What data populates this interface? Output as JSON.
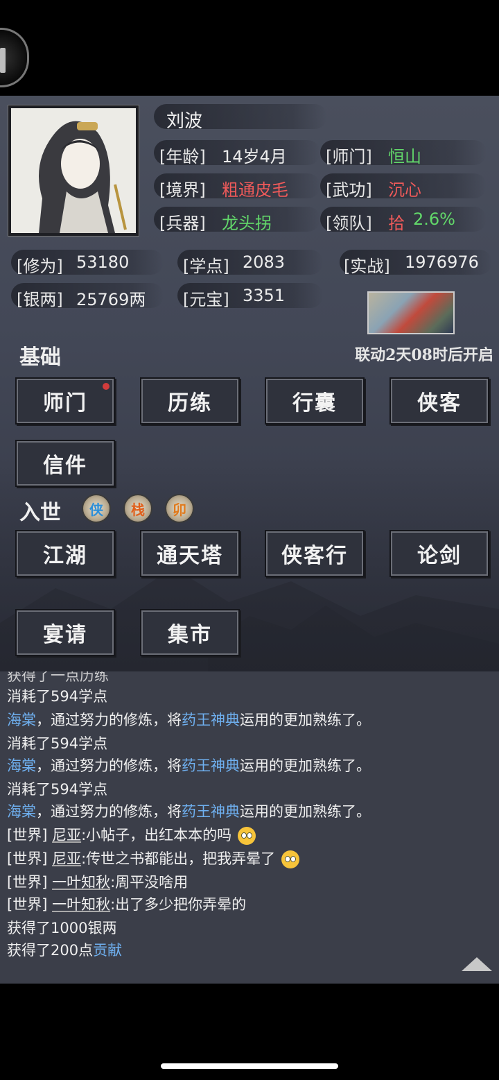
{
  "character": {
    "name": "刘波",
    "age_label": "[年龄]",
    "age_value": "14岁4月",
    "sect_label": "[师门]",
    "sect_value": "恒山",
    "realm_label": "[境界]",
    "realm_value": "粗通皮毛",
    "kungfu_label": "[武功]",
    "kungfu_value": "沉心",
    "weapon_label": "[兵器]",
    "weapon_value": "龙头拐",
    "team_label": "[领队]",
    "team_rank": "拾",
    "team_pct": "2.6%"
  },
  "stats": {
    "cultivation_label": "[修为]",
    "cultivation_value": "53180",
    "study_label": "[学点]",
    "study_value": "2083",
    "combat_label": "[实战]",
    "combat_value": "1976976",
    "silver_label": "[银两]",
    "silver_value": "25769两",
    "ingot_label": "[元宝]",
    "ingot_value": "3351"
  },
  "basics": {
    "title": "基础",
    "countdown": "联动2天08时后开启",
    "buttons": [
      "师门",
      "历练",
      "行囊",
      "侠客",
      "信件"
    ]
  },
  "world": {
    "title": "入世",
    "badges": [
      "侠",
      "栈",
      "卯"
    ],
    "buttons": [
      "江湖",
      "通天塔",
      "侠客行",
      "论剑",
      "宴请",
      "集市"
    ]
  },
  "log": {
    "partial_top": "获得了一点历练",
    "consume": "消耗了594学点",
    "train_actor": "海棠",
    "train_mid": "，通过努力的修炼，将",
    "train_skill": "药王神典",
    "train_tail": "运用的更加熟练了。",
    "world_tag": "[世界]",
    "chat1_name": "尼亚",
    "chat1_text": ":小帖子，出红本本的吗",
    "chat2_name": "尼亚",
    "chat2_text": ":传世之书都能出，把我弄晕了",
    "chat3_name": "一叶知秋",
    "chat3_text": ":周平没啥用",
    "chat4_name": "一叶知秋",
    "chat4_text": ":出了多少把你弄晕的",
    "gain_silver": "获得了1000银两",
    "gain_contrib_prefix": "获得了200点",
    "gain_contrib_word": "贡献"
  },
  "icons": [
    "back-icon",
    "scroll-up-icon",
    "red-dot-icon",
    "eye-roll-emoji-icon",
    "dizzy-emoji-icon"
  ],
  "colors": {
    "green": "#62d86a",
    "red": "#ef5a5a",
    "blue": "#6fb0f0",
    "panel": "#434857",
    "log_bg": "#3b3e49"
  }
}
